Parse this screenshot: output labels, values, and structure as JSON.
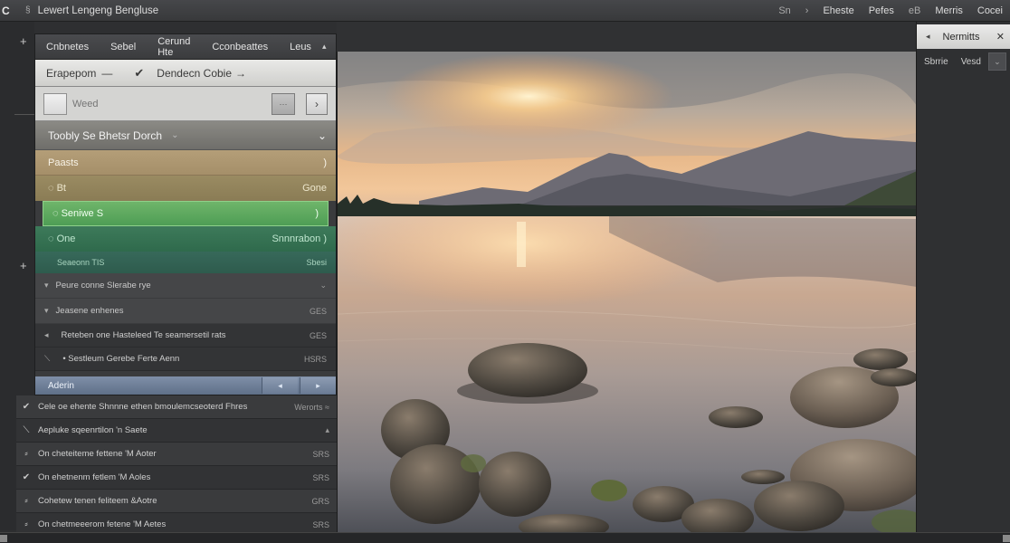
{
  "menubar": {
    "logo": "C",
    "sep_icon": "chevron-icon",
    "title": "Lewert Lengeng Bengluse",
    "right": [
      "Sn",
      "›",
      "Eheste",
      "Pefes",
      "eB",
      "Merris",
      "Cocei"
    ]
  },
  "panel": {
    "tabs": [
      "Cnbnetes",
      "Sebel",
      "Cerund Hte",
      "Cconbeattes",
      "Leus"
    ],
    "tab_caret": "▴",
    "breadcrumb": {
      "item1": "Erapepom",
      "dash": "—",
      "check": "✔",
      "item2": "Dendecn Cobie",
      "arrow": "→"
    },
    "search": {
      "placeholder": "Weed",
      "next": "›",
      "small_btn": "···"
    },
    "layers": {
      "title": "Toobly Se Bhetsr Dorch",
      "title_chev": "⌄",
      "title_right": "⌄",
      "tan1_label": "Paasts",
      "tan1_right": ")",
      "tan2_label": "◌ Bt",
      "tan2_right": "Gone",
      "green_label": "◌ Seniwe S",
      "green_right": ")",
      "teal_label": "◌ One",
      "teal_right": "Snnnrabon )",
      "teal2_label": "Seaeonn TIS",
      "teal2_right": "Sbesi"
    },
    "rows": [
      {
        "arrow": "▾",
        "label": "Peure conne Slerabe rye",
        "right": "⌄"
      },
      {
        "arrow": "▾",
        "label": "Jeasene enhenes",
        "right": "GES"
      }
    ],
    "rows2": [
      {
        "arrow": "◂",
        "label": "Reteben one Hasteleed Te seamersetil rats",
        "right": "GES"
      },
      {
        "arrow": "⟍",
        "label": "• Sestleum Gerebe Ferte Aenn",
        "right": "HSRS"
      }
    ],
    "footer": {
      "label": "Aderin",
      "btn1": "◂",
      "btn2": "▸"
    }
  },
  "list": [
    {
      "icon": "✔",
      "label": "Cele oe ehente Shnnne ethen bmoulemcseoterd Fhres",
      "right": "Werorts ≈"
    },
    {
      "icon": "⟍",
      "label": "Aepluke sqeenrtilon 'n Saete",
      "right": "▴"
    },
    {
      "icon": "⸗",
      "label": "On cheteiteme fettene 'M Aoter",
      "right": "SRS"
    },
    {
      "icon": "✔",
      "label": "On ehetnenm fetlem 'M Aoles",
      "right": "SRS"
    },
    {
      "icon": "⸗",
      "label": "Cohetew tenen feliteem &Aotre",
      "right": "GRS"
    },
    {
      "icon": "⸗",
      "label": "On chetmeeerom fetene 'M Aetes",
      "right": "SRS"
    }
  ],
  "rpanel": {
    "tri": "◂",
    "title": "Nermitts",
    "close": "✕",
    "opt1": "Sbrrie",
    "opt2": "Vesd",
    "dd": "⌄"
  },
  "gutter_plus": [
    "+",
    "+"
  ]
}
